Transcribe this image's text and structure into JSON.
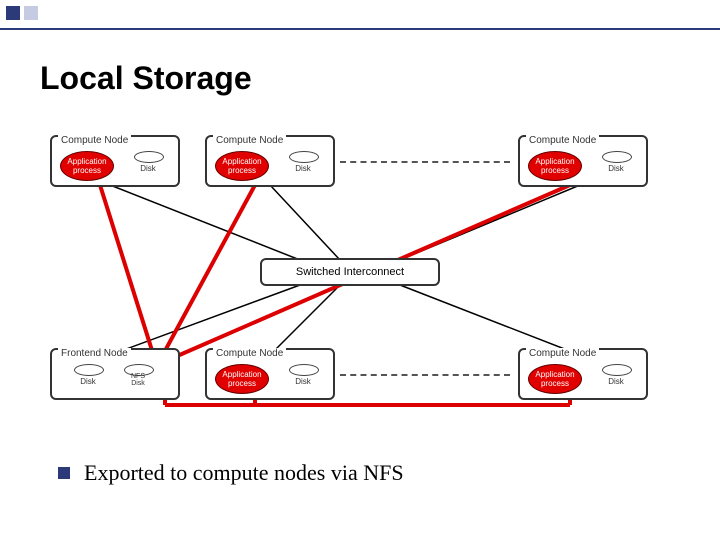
{
  "slide": {
    "title": "Local Storage",
    "bullet": "Exported to compute nodes via NFS"
  },
  "diagram": {
    "interconnect": "Switched Interconnect",
    "top_nodes": [
      {
        "title": "Compute Node",
        "proc1": "Application",
        "proc2": "process",
        "disk": "Disk"
      },
      {
        "title": "Compute Node",
        "proc1": "Application",
        "proc2": "process",
        "disk": "Disk"
      },
      {
        "title": "Compute Node",
        "proc1": "Application",
        "proc2": "process",
        "disk": "Disk"
      }
    ],
    "bottom_left": {
      "title": "Frontend Node",
      "disk1": "Disk",
      "disk2a": "NFS",
      "disk2b": "Disk"
    },
    "bottom_nodes": [
      {
        "title": "Compute Node",
        "proc1": "Application",
        "proc2": "process",
        "disk": "Disk"
      },
      {
        "title": "Compute Node",
        "proc1": "Application",
        "proc2": "process",
        "disk": "Disk"
      }
    ]
  }
}
